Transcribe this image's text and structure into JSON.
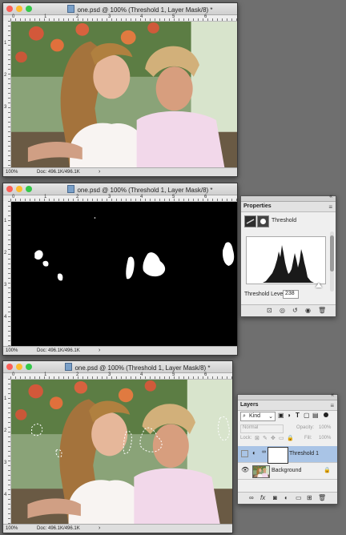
{
  "windows": [
    {
      "title": "one.psd @ 100% (Threshold 1, Layer Mask/8) *",
      "zoom": "100%",
      "doc": "Doc: 496.1K/496.1K",
      "ruler_top": [
        "0",
        "1",
        "2",
        "3",
        "4",
        "5",
        "6"
      ],
      "ruler_left": [
        "1",
        "2",
        "3"
      ]
    },
    {
      "title": "one.psd @ 100% (Threshold 1, Layer Mask/8) *",
      "zoom": "100%",
      "doc": "Doc: 496.1K/496.1K",
      "ruler_top": [
        "0",
        "1",
        "2",
        "3",
        "4",
        "5",
        "6"
      ],
      "ruler_left": [
        "1",
        "2",
        "3",
        "4"
      ]
    },
    {
      "title": "one.psd @ 100% (Threshold 1, Layer Mask/8) *",
      "zoom": "100%",
      "doc": "Doc: 496.1K/496.1K",
      "ruler_top": [
        "0",
        "1",
        "2",
        "3",
        "4",
        "5",
        "6"
      ],
      "ruler_left": [
        "1",
        "2",
        "3",
        "4"
      ]
    }
  ],
  "properties": {
    "tab": "Properties",
    "adjustment": "Threshold",
    "level_label": "Threshold Level:",
    "level_value": "238",
    "level_fraction": 0.93
  },
  "layers": {
    "tab": "Layers",
    "kind": "Kind",
    "blend_mode": "Normal",
    "opacity_label": "Opacity:",
    "opacity_value": "100%",
    "lock_label": "Lock:",
    "fill_label": "Fill:",
    "fill_value": "100%",
    "rows": [
      {
        "name": "Threshold 1",
        "selected": true
      },
      {
        "name": "Background",
        "selected": false
      }
    ]
  },
  "colors": {
    "selection": "#a9c4e6",
    "photo_green": "#4f7a3a",
    "shirt_pink": "#f2d8ea"
  }
}
